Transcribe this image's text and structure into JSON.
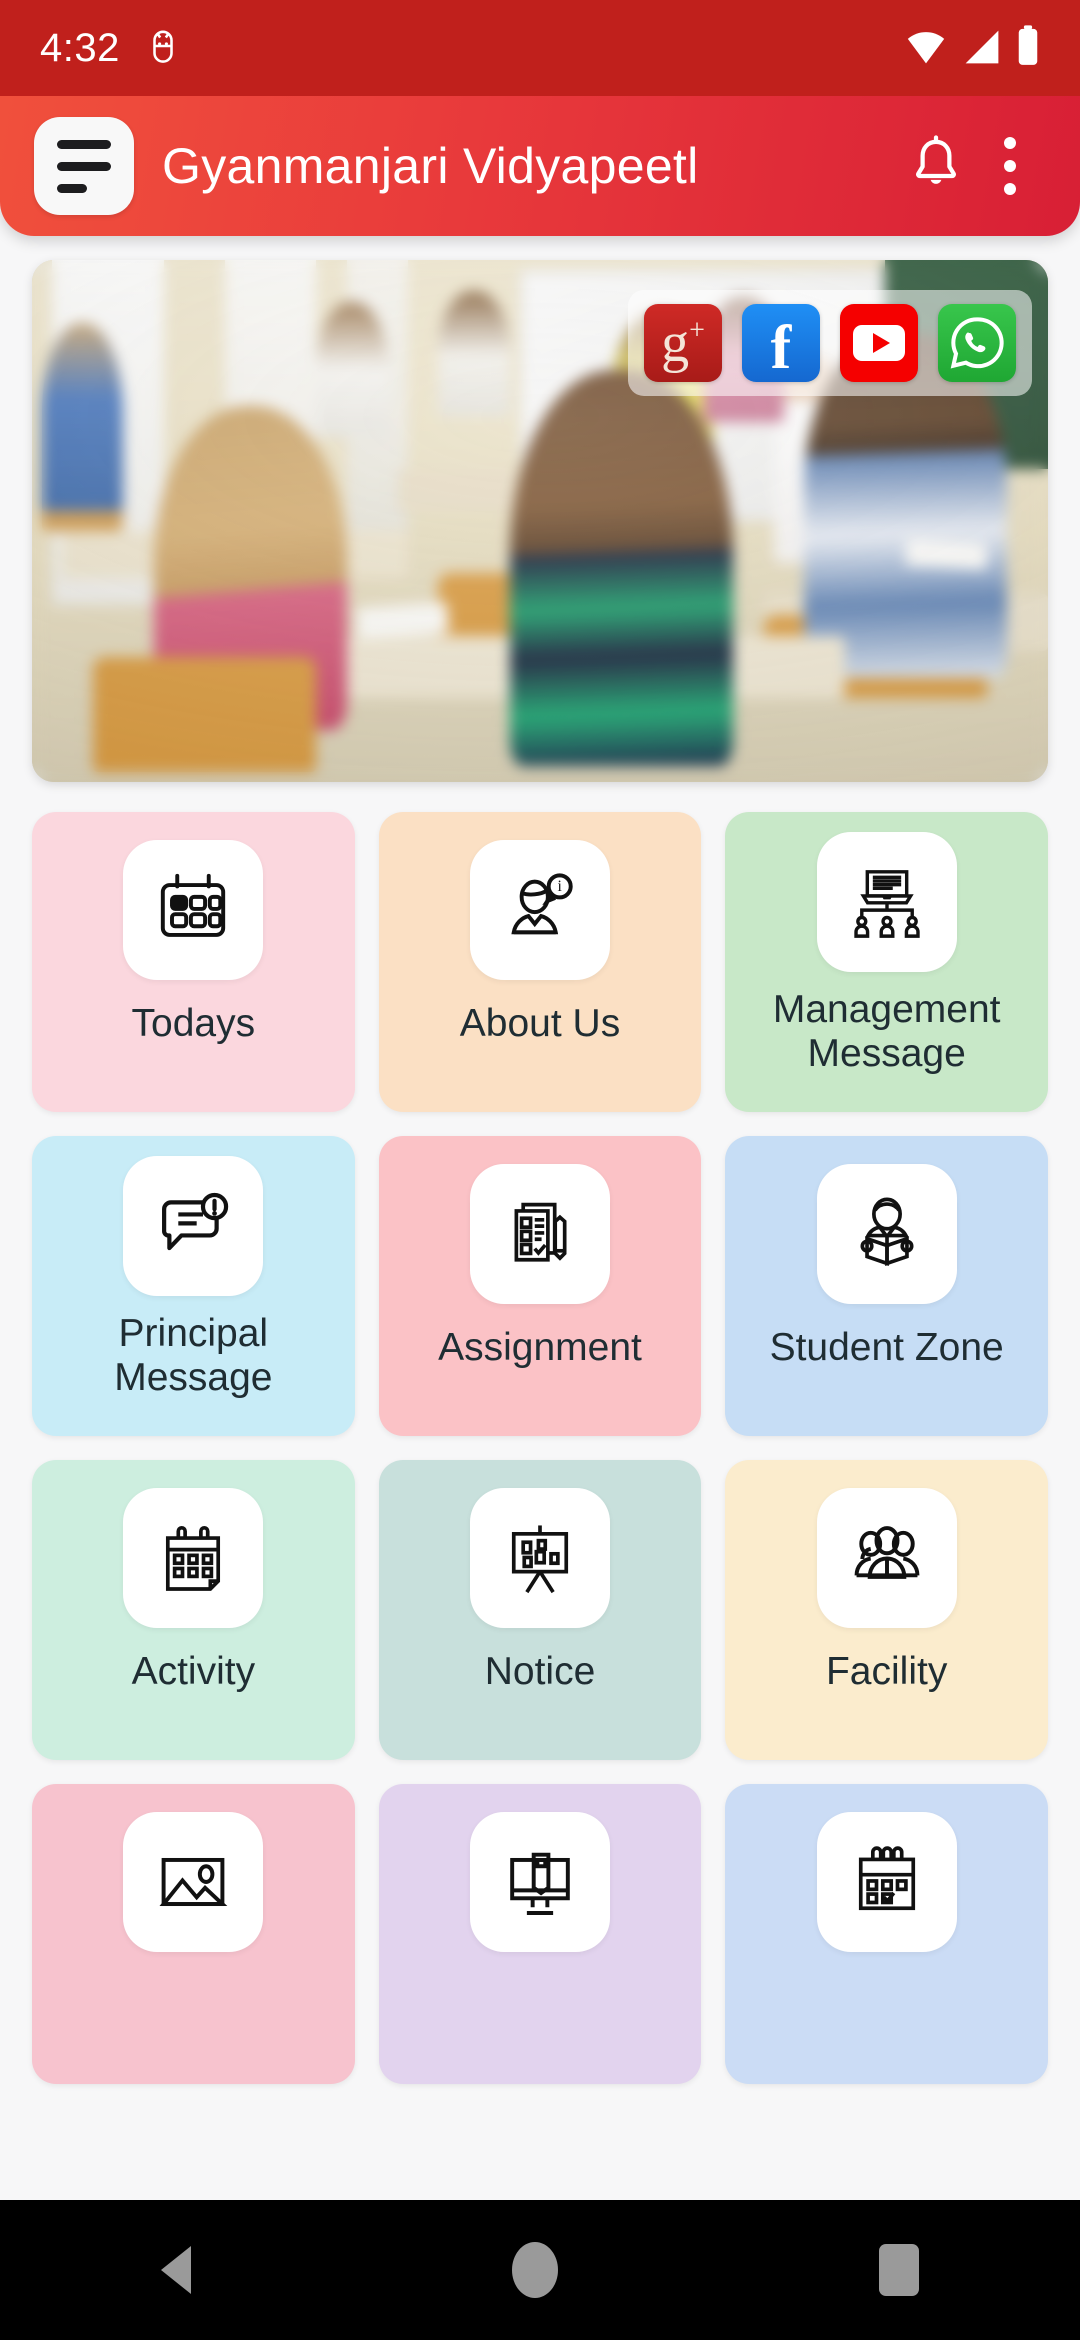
{
  "status_bar": {
    "clock": "4:32",
    "icons": [
      "usb-debug-icon",
      "wifi-icon",
      "cellular-signal-icon",
      "battery-icon"
    ]
  },
  "app_bar": {
    "menu_icon": "hamburger-menu-icon",
    "title": "Gyanmanjari Vidyapeetl",
    "notification_icon": "bell-icon",
    "overflow_icon": "more-vertical-icon",
    "gradient_from": "#f0503c",
    "gradient_to": "#d81f35"
  },
  "banner": {
    "alt": "classroom-photo",
    "social_links": [
      {
        "name": "google-plus-icon",
        "label": "g+",
        "color": "#cf2a26"
      },
      {
        "name": "facebook-icon",
        "label": "f",
        "color": "#1f8ff5"
      },
      {
        "name": "youtube-icon",
        "label": "play",
        "color": "#f50000"
      },
      {
        "name": "whatsapp-icon",
        "label": "whatsapp",
        "color": "#38c64c"
      }
    ]
  },
  "tiles": [
    {
      "label": "Todays",
      "icon": "calendar-today-icon",
      "bg": "#fbd7de",
      "two_line": false
    },
    {
      "label": "About Us",
      "icon": "person-info-icon",
      "bg": "#fbe0c4",
      "two_line": false
    },
    {
      "label": "Management\nMessage",
      "icon": "org-chart-icon",
      "bg": "#c8e8c8",
      "two_line": true
    },
    {
      "label": "Principal\nMessage",
      "icon": "chat-alert-icon",
      "bg": "#c8ecf7",
      "two_line": true
    },
    {
      "label": "Assignment",
      "icon": "checklist-pencil-icon",
      "bg": "#fbc2c6",
      "two_line": false
    },
    {
      "label": "Student Zone",
      "icon": "student-reading-icon",
      "bg": "#c6ddf5",
      "two_line": false
    },
    {
      "label": "Activity",
      "icon": "calendar-pages-icon",
      "bg": "#cdeedf",
      "two_line": false
    },
    {
      "label": "Notice",
      "icon": "notice-board-icon",
      "bg": "#c8e0dc",
      "two_line": false
    },
    {
      "label": "Facility",
      "icon": "people-group-icon",
      "bg": "#fbeccd",
      "two_line": false
    },
    {
      "label": "",
      "icon": "image-gallery-icon",
      "bg": "#f7c3ce",
      "two_line": false
    },
    {
      "label": "",
      "icon": "e-learning-monitor-icon",
      "bg": "#e2d3ee",
      "two_line": false
    },
    {
      "label": "",
      "icon": "calendar-check-icon",
      "bg": "#cbdcf5",
      "two_line": false
    }
  ],
  "nav_bar": {
    "back": "back-triangle-icon",
    "home": "home-circle-icon",
    "recents": "recents-square-icon"
  }
}
